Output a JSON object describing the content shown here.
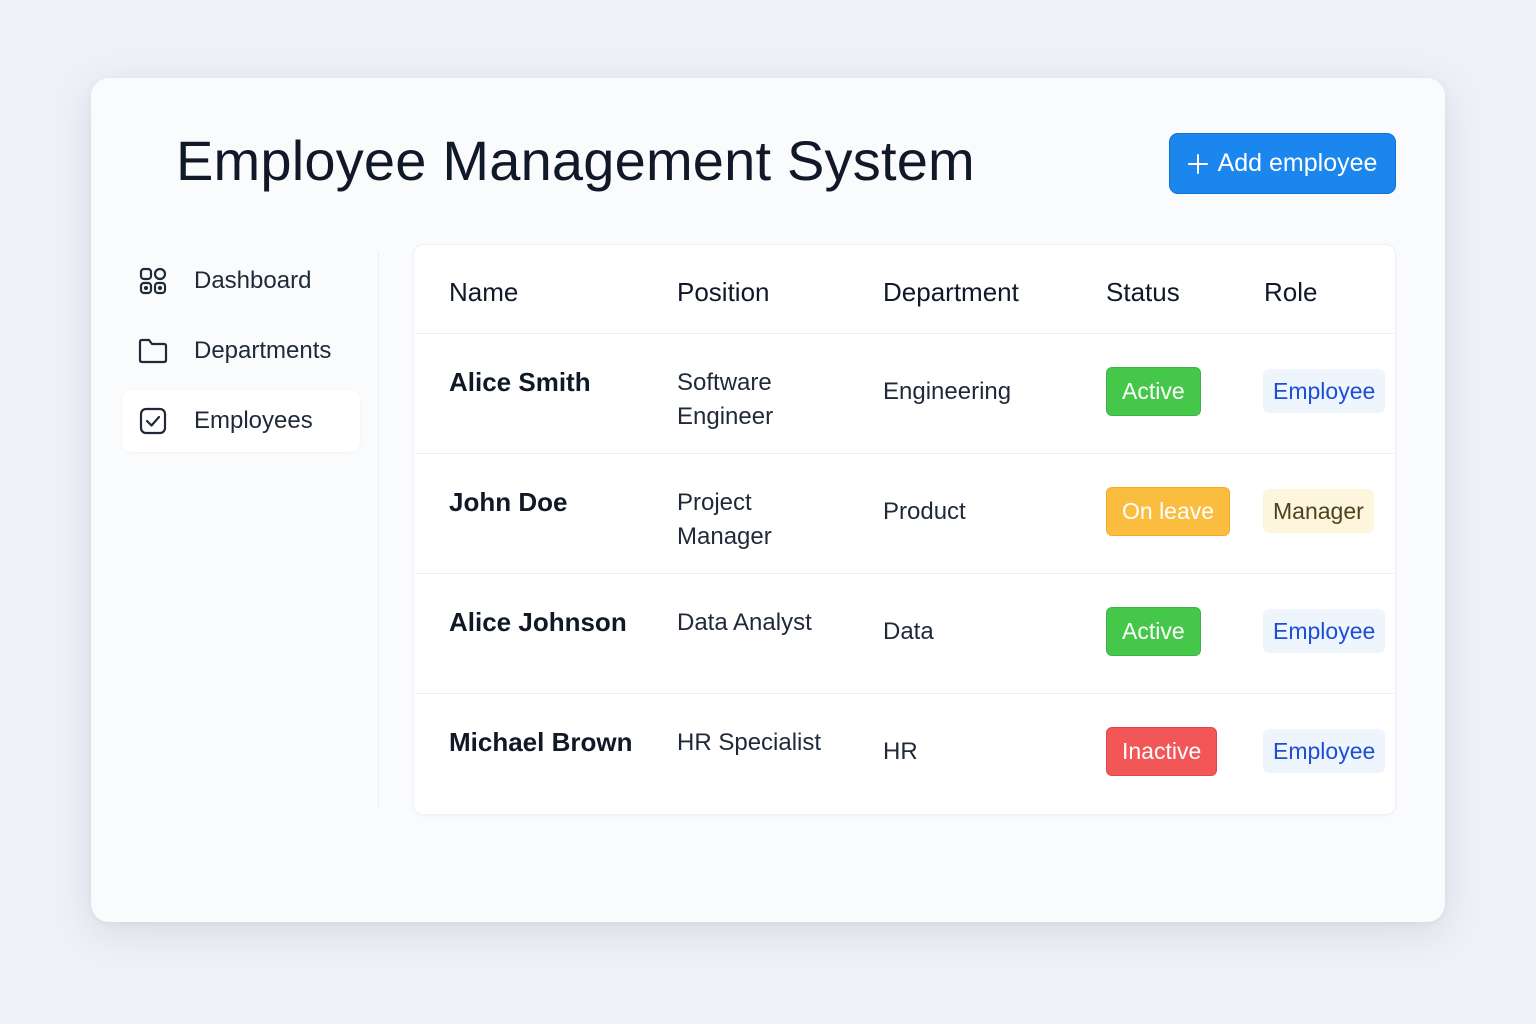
{
  "header": {
    "title": "Employee Management System",
    "add_button_label": "Add employee"
  },
  "sidebar": {
    "items": [
      {
        "label": "Dashboard",
        "icon": "grid-icon",
        "active": false
      },
      {
        "label": "Departments",
        "icon": "folder-icon",
        "active": false
      },
      {
        "label": "Employees",
        "icon": "checkbox-icon",
        "active": true
      }
    ]
  },
  "table": {
    "columns": [
      "Name",
      "Position",
      "Department",
      "Status",
      "Role"
    ],
    "rows": [
      {
        "name": "Alice Smith",
        "position": "Software Engineer",
        "department": "Engineering",
        "status": "Active",
        "role": "Employee"
      },
      {
        "name": "John Doe",
        "position": "Project Manager",
        "department": "Product",
        "status": "On leave",
        "role": "Manager"
      },
      {
        "name": "Alice Johnson",
        "position": "Data Analyst",
        "department": "Data",
        "status": "Active",
        "role": "Employee"
      },
      {
        "name": "Michael Brown",
        "position": "HR Specialist",
        "department": "HR",
        "status": "Inactive",
        "role": "Employee"
      }
    ]
  },
  "colors": {
    "primary": "#1a86ee",
    "status_active": "#45c74a",
    "status_on_leave": "#fbbd3f",
    "status_inactive": "#f25656",
    "role_employee_bg": "#eef5fd",
    "role_employee_text": "#1d4ed8",
    "role_manager_bg": "#fdf6dc",
    "role_manager_text": "#4b4220"
  }
}
